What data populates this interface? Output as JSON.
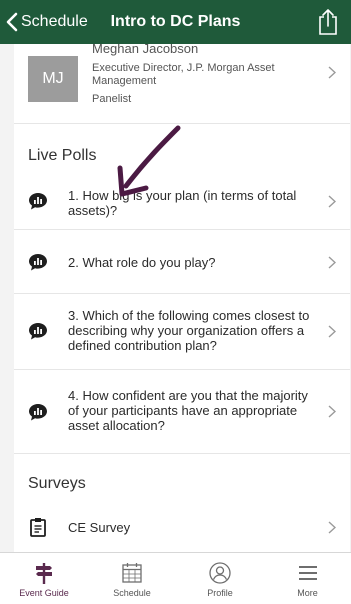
{
  "navbar": {
    "back_label": "Schedule",
    "title": "Intro to DC Plans"
  },
  "speaker": {
    "initials": "MJ",
    "name": "Meghan Jacobson",
    "title": "Executive Director, J.P. Morgan Asset Management",
    "role": "Panelist"
  },
  "live_polls": {
    "heading": "Live Polls",
    "items": [
      {
        "label": "1. How big is your plan (in terms of total assets)?"
      },
      {
        "label": "2. What role do you play?"
      },
      {
        "label": "3. Which of the following comes closest to describing why your organization offers a defined contribution plan?"
      },
      {
        "label": "4. How confident are you that the majority of your participants have an appropriate asset allocation?"
      }
    ]
  },
  "surveys": {
    "heading": "Surveys",
    "items": [
      {
        "label": "CE Survey"
      }
    ]
  },
  "tabbar": {
    "items": [
      {
        "label": "Event Guide",
        "icon": "signpost-icon",
        "active": true
      },
      {
        "label": "Schedule",
        "icon": "calendar-icon"
      },
      {
        "label": "Profile",
        "icon": "profile-icon"
      },
      {
        "label": "More",
        "icon": "menu-icon"
      }
    ]
  },
  "colors": {
    "navbar": "#1f5a3a",
    "active_tab": "#5a2a4e",
    "annotation_arrow": "#4b1a43"
  }
}
